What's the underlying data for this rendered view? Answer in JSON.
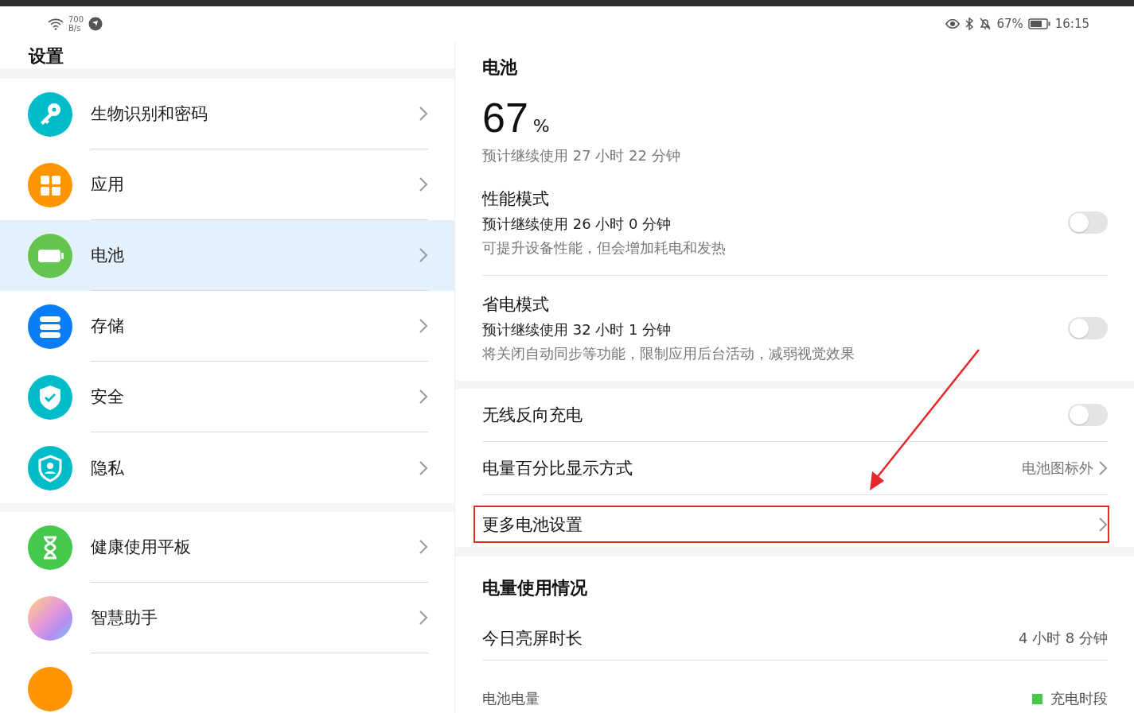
{
  "status_bar": {
    "speed_value": "700",
    "speed_unit": "B/s",
    "battery": "67%",
    "time": "16:15"
  },
  "sidebar": {
    "title": "设置",
    "groups": [
      [
        {
          "label": "生物识别和密码",
          "kind": "key",
          "color": "#00bcc9",
          "selected": false
        },
        {
          "label": "应用",
          "kind": "apps",
          "color": "#ff9500",
          "selected": false
        },
        {
          "label": "电池",
          "kind": "battery",
          "color": "#63c54d",
          "selected": true
        },
        {
          "label": "存储",
          "kind": "storage",
          "color": "#0a7cf5",
          "selected": false
        },
        {
          "label": "安全",
          "kind": "shield",
          "color": "#00bcc9",
          "selected": false
        },
        {
          "label": "隐私",
          "kind": "privacy",
          "color": "#00bcc9",
          "selected": false
        }
      ],
      [
        {
          "label": "健康使用平板",
          "kind": "hourglass",
          "color": "#44c94a",
          "selected": false
        },
        {
          "label": "智慧助手",
          "kind": "orb",
          "selected": false
        },
        {
          "kind": "plain",
          "color": "#ff9500",
          "selected": false
        }
      ]
    ]
  },
  "battery": {
    "title": "电池",
    "percent": "67",
    "unit": "%",
    "estimate": "预计继续使用 27 小时 22 分钟",
    "modes": [
      {
        "title": "性能模式",
        "estimate": "预计继续使用 26 小时 0 分钟",
        "description": "可提升设备性能，但会增加耗电和发热",
        "on": false
      },
      {
        "title": "省电模式",
        "estimate": "预计继续使用 32 小时 1 分钟",
        "description": "将关闭自动同步等功能，限制应用后台活动，减弱视觉效果",
        "on": false
      }
    ],
    "settings": [
      {
        "kind": "toggle",
        "label": "无线反向充电",
        "on": false
      },
      {
        "kind": "link",
        "label": "电量百分比显示方式",
        "value": "电池图标外",
        "highlighted": false
      },
      {
        "kind": "link",
        "label": "更多电池设置",
        "highlighted": true
      }
    ],
    "usage": {
      "title": "电量使用情况",
      "screen_time_label": "今日亮屏时长",
      "screen_time": "4 小时 8 分钟",
      "level_label": "电池电量",
      "legend": [
        {
          "label": "充电时段",
          "color": "#44c94a"
        }
      ]
    }
  }
}
